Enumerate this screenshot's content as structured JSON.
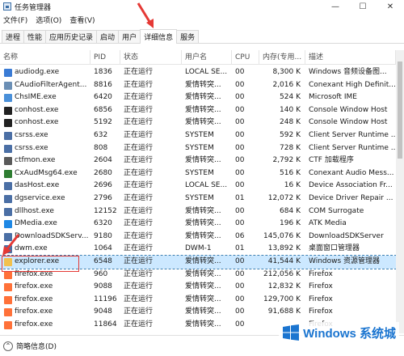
{
  "window": {
    "title": "任务管理器",
    "min": "—",
    "max": "☐",
    "close": "✕"
  },
  "menu": [
    "文件(F)",
    "选项(O)",
    "查看(V)"
  ],
  "tabs": [
    "进程",
    "性能",
    "应用历史记录",
    "启动",
    "用户",
    "详细信息",
    "服务"
  ],
  "active_tab": "详细信息",
  "columns": [
    "名称",
    "PID",
    "状态",
    "用户名",
    "CPU",
    "内存(专用...",
    "描述"
  ],
  "rows": [
    {
      "name": "audiodg.exe",
      "pid": "1836",
      "status": "正在运行",
      "user": "LOCAL SE...",
      "cpu": "00",
      "mem": "8,300 K",
      "desc": "Windows 音频设备图...",
      "icon_color": "#3a7bd5"
    },
    {
      "name": "CAudioFilterAgent...",
      "pid": "8816",
      "status": "正在运行",
      "user": "爱情转突...",
      "cpu": "00",
      "mem": "2,016 K",
      "desc": "Conexant High Definit...",
      "icon_color": "#6b8fb5"
    },
    {
      "name": "ChsIME.exe",
      "pid": "6420",
      "status": "正在运行",
      "user": "爱情转突...",
      "cpu": "00",
      "mem": "524 K",
      "desc": "Microsoft IME",
      "icon_color": "#4a90d9"
    },
    {
      "name": "conhost.exe",
      "pid": "6856",
      "status": "正在运行",
      "user": "爱情转突...",
      "cpu": "00",
      "mem": "140 K",
      "desc": "Console Window Host",
      "icon_color": "#222222"
    },
    {
      "name": "conhost.exe",
      "pid": "5192",
      "status": "正在运行",
      "user": "爱情转突...",
      "cpu": "00",
      "mem": "248 K",
      "desc": "Console Window Host",
      "icon_color": "#222222"
    },
    {
      "name": "csrss.exe",
      "pid": "632",
      "status": "正在运行",
      "user": "SYSTEM",
      "cpu": "00",
      "mem": "592 K",
      "desc": "Client Server Runtime ...",
      "icon_color": "#4b6fa5"
    },
    {
      "name": "csrss.exe",
      "pid": "808",
      "status": "正在运行",
      "user": "SYSTEM",
      "cpu": "00",
      "mem": "728 K",
      "desc": "Client Server Runtime ...",
      "icon_color": "#4b6fa5"
    },
    {
      "name": "ctfmon.exe",
      "pid": "2604",
      "status": "正在运行",
      "user": "爱情转突...",
      "cpu": "00",
      "mem": "2,792 K",
      "desc": "CTF 加载程序",
      "icon_color": "#5a5a5a"
    },
    {
      "name": "CxAudMsg64.exe",
      "pid": "2680",
      "status": "正在运行",
      "user": "SYSTEM",
      "cpu": "00",
      "mem": "516 K",
      "desc": "Conexant Audio Mess...",
      "icon_color": "#2e7d32"
    },
    {
      "name": "dasHost.exe",
      "pid": "2696",
      "status": "正在运行",
      "user": "LOCAL SE...",
      "cpu": "00",
      "mem": "16 K",
      "desc": "Device Association Fr...",
      "icon_color": "#4b6fa5"
    },
    {
      "name": "dgservice.exe",
      "pid": "2796",
      "status": "正在运行",
      "user": "SYSTEM",
      "cpu": "01",
      "mem": "12,072 K",
      "desc": "Device Driver Repair ...",
      "icon_color": "#4b6fa5"
    },
    {
      "name": "dllhost.exe",
      "pid": "12152",
      "status": "正在运行",
      "user": "爱情转突...",
      "cpu": "00",
      "mem": "684 K",
      "desc": "COM Surrogate",
      "icon_color": "#4b6fa5"
    },
    {
      "name": "DMedia.exe",
      "pid": "6320",
      "status": "正在运行",
      "user": "爱情转突...",
      "cpu": "00",
      "mem": "196 K",
      "desc": "ATK Media",
      "icon_color": "#1e88e5"
    },
    {
      "name": "DownloadSDKServ...",
      "pid": "9180",
      "status": "正在运行",
      "user": "爱情转突...",
      "cpu": "06",
      "mem": "145,076 K",
      "desc": "DownloadSDKServer",
      "icon_color": "#4b6fa5"
    },
    {
      "name": "dwm.exe",
      "pid": "1064",
      "status": "正在运行",
      "user": "DWM-1",
      "cpu": "01",
      "mem": "13,892 K",
      "desc": "桌面窗口管理器",
      "icon_color": "#4b6fa5"
    },
    {
      "name": "explorer.exe",
      "pid": "6548",
      "status": "正在运行",
      "user": "爱情转突...",
      "cpu": "00",
      "mem": "41,544 K",
      "desc": "Windows 资源管理器",
      "icon_color": "#f2c14e",
      "selected": true
    },
    {
      "name": "firefox.exe",
      "pid": "960",
      "status": "正在运行",
      "user": "爱情转突...",
      "cpu": "00",
      "mem": "212,056 K",
      "desc": "Firefox",
      "icon_color": "#ff7139"
    },
    {
      "name": "firefox.exe",
      "pid": "9088",
      "status": "正在运行",
      "user": "爱情转突...",
      "cpu": "00",
      "mem": "12,832 K",
      "desc": "Firefox",
      "icon_color": "#ff7139"
    },
    {
      "name": "firefox.exe",
      "pid": "11196",
      "status": "正在运行",
      "user": "爱情转突...",
      "cpu": "00",
      "mem": "129,700 K",
      "desc": "Firefox",
      "icon_color": "#ff7139"
    },
    {
      "name": "firefox.exe",
      "pid": "9048",
      "status": "正在运行",
      "user": "爱情转突...",
      "cpu": "00",
      "mem": "91,688 K",
      "desc": "Firefox",
      "icon_color": "#ff7139"
    },
    {
      "name": "firefox.exe",
      "pid": "11864",
      "status": "正在运行",
      "user": "爱情转突...",
      "cpu": "00",
      "mem": "",
      "desc": "Firefox",
      "icon_color": "#ff7139"
    }
  ],
  "footer": {
    "fewer_details": "简略信息(D)"
  },
  "watermark": {
    "text": "Windows 系统城"
  },
  "colors": {
    "selection": "#cce8ff",
    "annotation": "#e53935",
    "watermark": "#1b75d0"
  }
}
